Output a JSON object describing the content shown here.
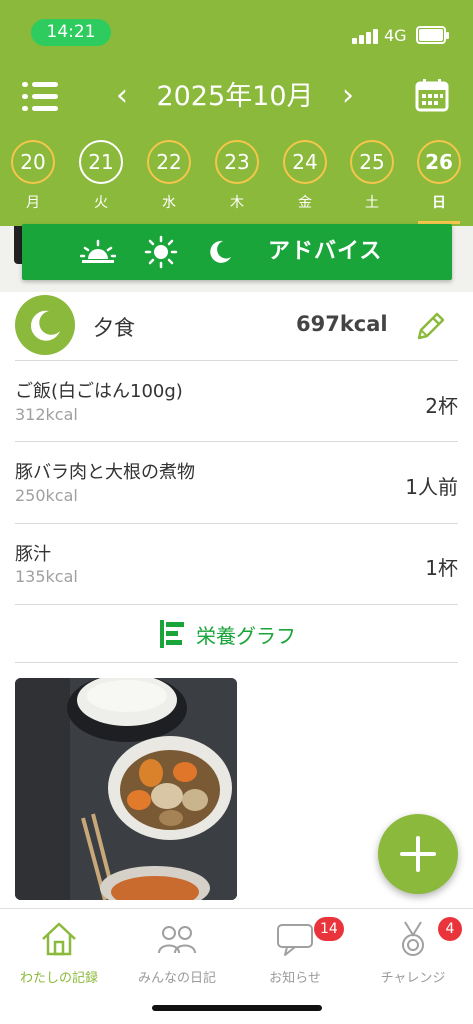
{
  "status_bar": {
    "time": "14:21",
    "network": "4G"
  },
  "header": {
    "month_title": "2025年10月",
    "prev_symbol": "‹",
    "next_symbol": "›",
    "colors": {
      "header_bg": "#8bb93b",
      "ring": "#f4c64b"
    },
    "days": [
      {
        "num": "20",
        "dow": "月"
      },
      {
        "num": "21",
        "dow": "火"
      },
      {
        "num": "22",
        "dow": "水"
      },
      {
        "num": "23",
        "dow": "木"
      },
      {
        "num": "24",
        "dow": "金"
      },
      {
        "num": "25",
        "dow": "土"
      },
      {
        "num": "26",
        "dow": "日",
        "selected": true
      }
    ]
  },
  "advice_bar": {
    "label": "アドバイス",
    "icons": [
      "sunrise-icon",
      "sun-icon",
      "moon-icon"
    ],
    "color": "#1aa53a"
  },
  "meal": {
    "icon": "moon-icon",
    "name": "夕食",
    "kcal": "697kcal",
    "items": [
      {
        "name": "ご飯(白ごはん100g)",
        "kcal": "312kcal",
        "qty": "2杯"
      },
      {
        "name": "豚バラ肉と大根の煮物",
        "kcal": "250kcal",
        "qty": "1人前"
      },
      {
        "name": "豚汁",
        "kcal": "135kcal",
        "qty": "1杯"
      }
    ],
    "graph_link": "栄養グラフ"
  },
  "tabbar": {
    "tabs": [
      {
        "label": "わたしの記録",
        "icon": "home-icon",
        "active": true
      },
      {
        "label": "みんなの日記",
        "icon": "people-icon"
      },
      {
        "label": "お知らせ",
        "icon": "chat-icon",
        "badge": "14"
      },
      {
        "label": "チャレンジ",
        "icon": "medal-icon",
        "badge": "4"
      }
    ]
  }
}
